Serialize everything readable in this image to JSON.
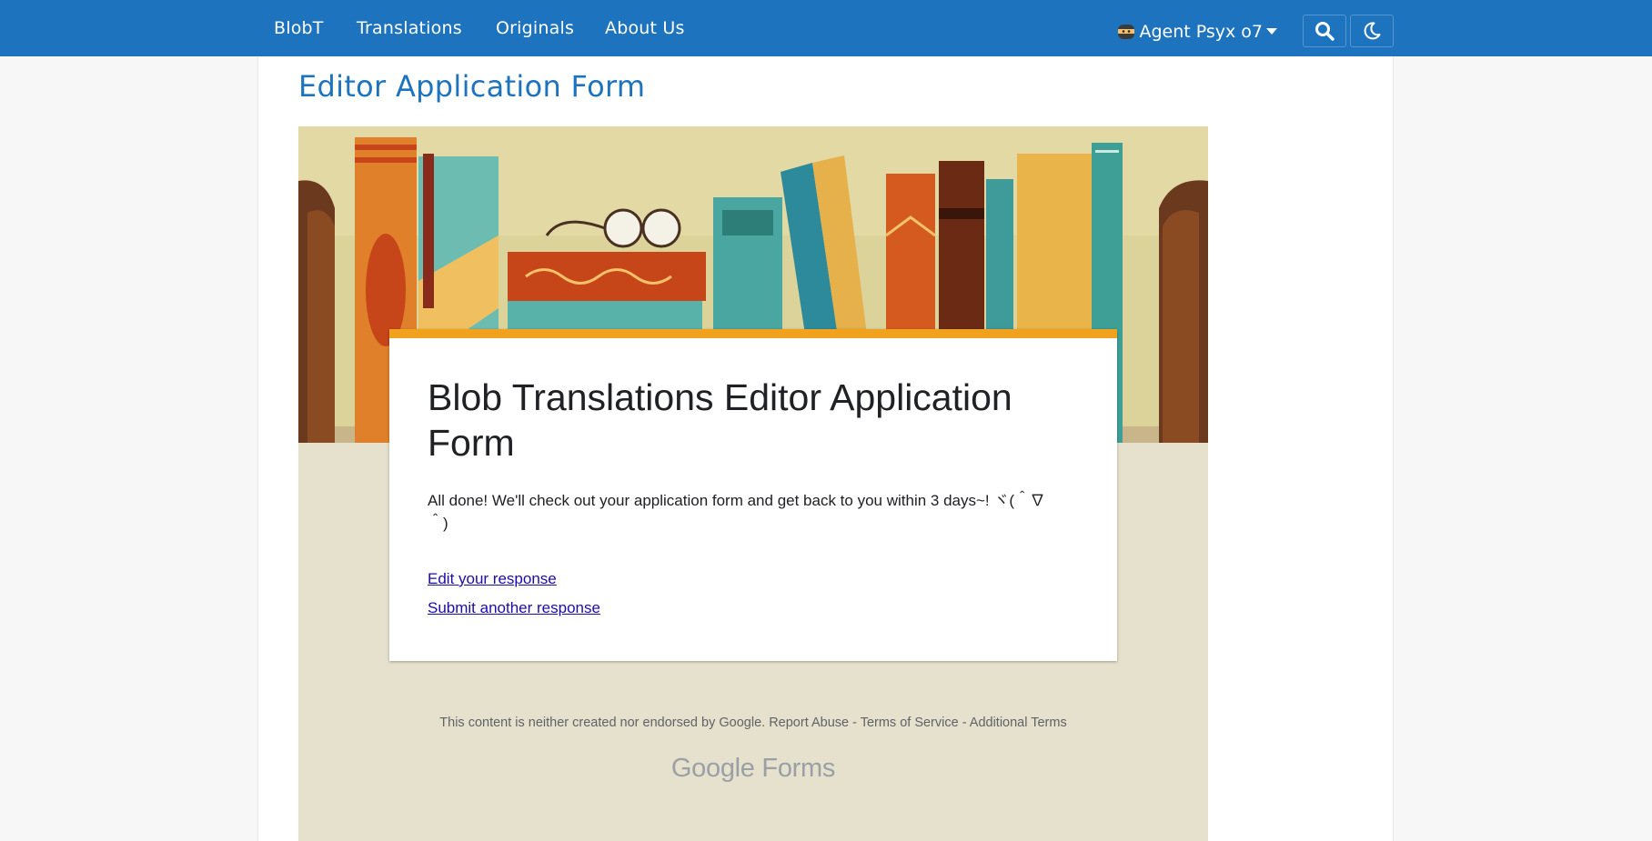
{
  "nav": {
    "links": [
      "BlobT",
      "Translations",
      "Originals",
      "About Us"
    ],
    "user_name": "Agent Psyx o7",
    "user_icon": "ninja-emoji-icon",
    "search_icon": "search-icon",
    "theme_icon": "moon-icon",
    "bar_color": "#1e73be"
  },
  "page": {
    "title": "Editor Application Form"
  },
  "form": {
    "title": "Blob Translations Editor Application Form",
    "message": "All done! We'll check out your application form and get back to you within 3 days~! ヾ(＾∇＾)",
    "edit_link": "Edit your response",
    "another_link": "Submit another response",
    "accent_color": "#f0a21e",
    "background_color": "#e5e1cd"
  },
  "footer": {
    "disclaimer": "This content is neither created nor endorsed by Google.",
    "report_abuse": "Report Abuse",
    "terms": "Terms of Service",
    "additional_terms": "Additional Terms",
    "separator": " - ",
    "brand_google": "Google",
    "brand_forms": "Forms"
  }
}
